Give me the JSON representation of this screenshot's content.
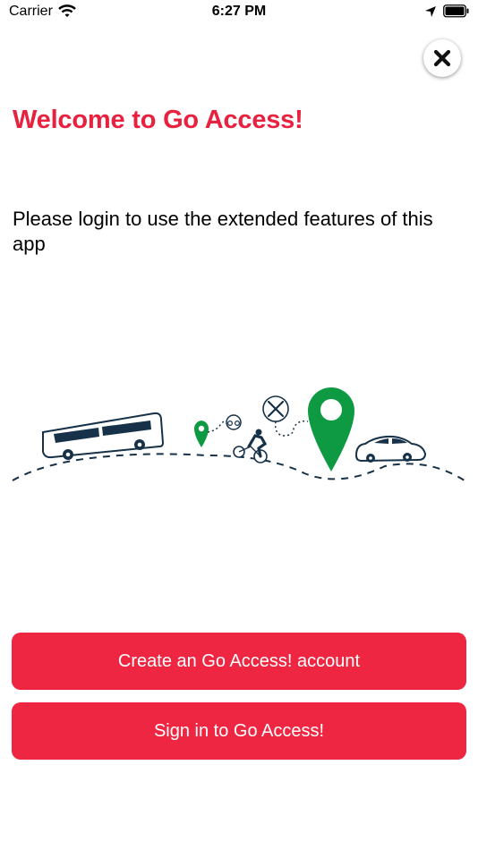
{
  "status_bar": {
    "carrier": "Carrier",
    "time": "6:27 PM"
  },
  "header": {
    "title": "Welcome to Go Access!"
  },
  "main": {
    "description": "Please login to use the extended features of this app"
  },
  "actions": {
    "create_account_label": "Create an Go Access! account",
    "sign_in_label": "Sign in to Go Access!"
  },
  "colors": {
    "accent": "#ef2641",
    "title": "#e8213f",
    "pin_green": "#0e9a43",
    "navy": "#173248"
  }
}
